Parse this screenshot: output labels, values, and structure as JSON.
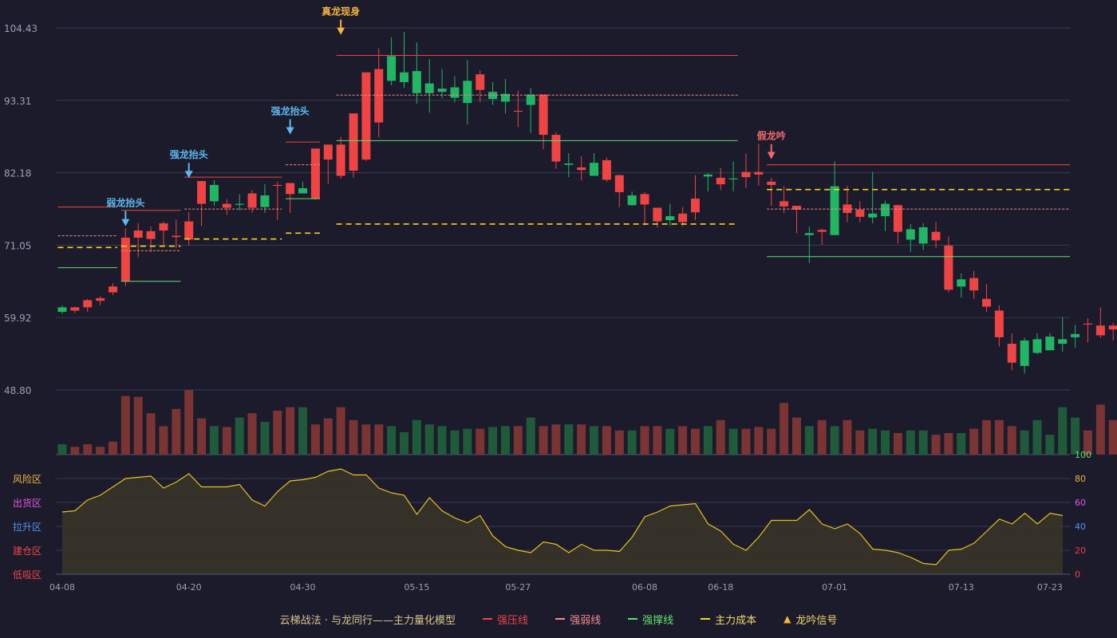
{
  "legend": {
    "title": "云梯战法 · 与龙同行——主力量化模型",
    "items": [
      {
        "label": "强压线",
        "color": "#ef4444",
        "style": "solid"
      },
      {
        "label": "强弱线",
        "color": "#f08c8c",
        "style": "dashed"
      },
      {
        "label": "强撑线",
        "color": "#62e06a",
        "style": "solid"
      },
      {
        "label": "主力成本",
        "color": "#f7d51c",
        "style": "dashed"
      },
      {
        "label": "龙吟信号",
        "color": "#f2b33d",
        "style": "triangle"
      }
    ]
  },
  "chart_data": {
    "type": "candlestick",
    "x_axis": {
      "categories": [
        "04-08",
        "04-09",
        "04-10",
        "04-11",
        "04-12",
        "04-15",
        "04-16",
        "04-17",
        "04-18",
        "04-19",
        "04-20",
        "04-22",
        "04-23",
        "04-24",
        "04-25",
        "04-26",
        "04-27",
        "04-28",
        "04-29",
        "04-30",
        "05-01",
        "05-06",
        "05-07",
        "05-08",
        "05-09",
        "05-10",
        "05-13",
        "05-14",
        "05-15",
        "05-16",
        "05-17",
        "05-20",
        "05-21",
        "05-22",
        "05-23",
        "05-24",
        "05-27",
        "05-28",
        "05-29",
        "05-30",
        "05-31",
        "06-03",
        "06-04",
        "06-05",
        "06-06",
        "06-07",
        "06-08",
        "06-11",
        "06-12",
        "06-13",
        "06-14",
        "06-17",
        "06-18",
        "06-19",
        "06-20",
        "06-21",
        "06-24",
        "06-25",
        "06-26",
        "06-27",
        "06-28",
        "07-01",
        "07-02",
        "07-03",
        "07-04",
        "07-05",
        "07-08",
        "07-09",
        "07-10",
        "07-11",
        "07-12",
        "07-13",
        "07-15",
        "07-16",
        "07-17",
        "07-18",
        "07-19",
        "07-22",
        "07-23",
        "07-24",
        "07-25",
        "07-26",
        "07-29",
        "07-30",
        "07-31",
        "08-01",
        "08-02"
      ],
      "tick_labels": [
        "04-08",
        "04-20",
        "04-30",
        "05-15",
        "05-27",
        "06-08",
        "06-18",
        "07-01",
        "07-13",
        "07-23"
      ]
    },
    "price_axis": {
      "ticks": [
        "104.43",
        "93.31",
        "82.18",
        "71.05",
        "59.92",
        "48.80"
      ],
      "range": [
        48.8,
        104.43
      ]
    },
    "candles": {
      "open": [
        61.5,
        61.0,
        61.5,
        62.5,
        63.8,
        65.5,
        72.2,
        72.0,
        73.3,
        72.3,
        71.9,
        77.4,
        80.3,
        76.8,
        77.4,
        76.8,
        78.7,
        80.3,
        78.9,
        79.8,
        78.2,
        84.2,
        81.7,
        82.5,
        84.2,
        89.9,
        100.1,
        97.6,
        97.8,
        95.9,
        95.1,
        95.3,
        96.3,
        94.9,
        94.6,
        94.3,
        91.6,
        94.2,
        88.0,
        83.9,
        83.6,
        82.6,
        83.7,
        81.1,
        79.2,
        78.7,
        77.3,
        74.7,
        75.5,
        74.6,
        76.1,
        81.9,
        80.4,
        81.3,
        81.5,
        81.9,
        80.3,
        77.0,
        76.5,
        72.9,
        73.1,
        80.1,
        76.0,
        75.4,
        75.9,
        77.4,
        73.1,
        73.5,
        73.8,
        71.8,
        64.2,
        65.8,
        64.1,
        61.6,
        56.9,
        53.0,
        56.4,
        56.6,
        57.0,
        56.6,
        57.4,
        59.0,
        57.2,
        58.1,
        58.1,
        57.4,
        59.3
      ],
      "high": [
        61.8,
        61.6,
        62.8,
        63.2,
        65.2,
        73.6,
        74.4,
        73.9,
        74.7,
        75.0,
        76.1,
        80.8,
        81.0,
        78.1,
        78.9,
        79.5,
        80.4,
        80.8,
        80.5,
        80.8,
        84.6,
        86.0,
        87.7,
        87.7,
        90.3,
        101.3,
        103.0,
        103.8,
        102.2,
        99.6,
        98.1,
        97.0,
        99.5,
        97.9,
        96.1,
        96.6,
        94.8,
        95.2,
        94.1,
        88.4,
        85.2,
        84.7,
        85.2,
        84.5,
        81.9,
        79.3,
        79.2,
        75.8,
        77.4,
        76.9,
        81.8,
        82.1,
        82.9,
        83.9,
        85.1,
        86.6,
        81.4,
        80.1,
        76.5,
        73.9,
        73.6,
        83.9,
        80.2,
        77.8,
        82.3,
        77.9,
        77.3,
        74.3,
        74.4,
        74.6,
        72.4,
        66.7,
        67.1,
        65.0,
        61.8,
        57.5,
        56.8,
        57.5,
        57.5,
        60.0,
        58.8,
        59.8,
        61.5,
        59.1,
        60.4,
        59.8,
        59.9
      ],
      "low": [
        60.5,
        60.6,
        60.8,
        61.8,
        63.4,
        64.8,
        69.2,
        70.0,
        71.0,
        70.6,
        71.0,
        74.0,
        77.1,
        75.7,
        76.4,
        76.0,
        76.0,
        74.9,
        76.0,
        79.1,
        78.0,
        80.5,
        81.3,
        81.4,
        84.0,
        87.6,
        95.6,
        95.2,
        92.8,
        91.4,
        93.6,
        93.0,
        89.6,
        93.0,
        92.6,
        91.3,
        89.2,
        88.3,
        85.8,
        82.8,
        81.5,
        81.0,
        82.1,
        80.8,
        76.9,
        77.1,
        74.1,
        73.8,
        74.0,
        73.9,
        74.9,
        79.3,
        79.5,
        79.3,
        79.8,
        80.2,
        77.1,
        76.0,
        72.9,
        68.3,
        71.1,
        73.5,
        74.6,
        74.6,
        74.4,
        73.2,
        71.3,
        70.0,
        70.3,
        70.6,
        63.8,
        63.0,
        62.8,
        60.8,
        55.5,
        51.8,
        51.3,
        54.3,
        55.1,
        54.7,
        55.3,
        56.1,
        56.8,
        56.4,
        55.4,
        56.7,
        56.9
      ],
      "close": [
        60.8,
        61.5,
        62.6,
        62.9,
        64.7,
        72.2,
        73.3,
        73.2,
        74.4,
        72.5,
        74.7,
        80.9,
        77.8,
        77.4,
        77.3,
        79.0,
        76.9,
        80.3,
        80.6,
        79.0,
        85.9,
        86.5,
        86.5,
        91.3,
        97.6,
        98.1,
        96.3,
        96.1,
        94.4,
        94.4,
        94.6,
        93.7,
        92.9,
        97.3,
        93.5,
        93.1,
        91.7,
        92.6,
        94.2,
        88.0,
        83.4,
        83.0,
        81.7,
        84.1,
        81.8,
        77.2,
        78.9,
        76.8,
        74.9,
        75.9,
        78.2,
        81.6,
        81.4,
        81.2,
        82.3,
        82.3,
        80.8,
        77.8,
        77.1,
        72.6,
        73.4,
        72.6,
        77.3,
        76.5,
        75.3,
        75.5,
        77.2,
        71.9,
        71.3,
        73.1,
        71.0,
        64.7,
        66.0,
        62.8,
        61.0,
        55.9,
        52.5,
        54.5,
        54.9,
        55.9,
        56.9,
        59.0,
        58.7,
        58.7,
        55.7,
        57.8,
        58.1
      ]
    },
    "volume": {
      "values": [
        12,
        9,
        12,
        9,
        15,
        68,
        67,
        48,
        33,
        53,
        75,
        42,
        33,
        32,
        43,
        48,
        38,
        51,
        55,
        55,
        35,
        42,
        55,
        40,
        35,
        35,
        33,
        26,
        40,
        35,
        33,
        28,
        30,
        30,
        32,
        33,
        33,
        43,
        33,
        35,
        35,
        35,
        33,
        33,
        28,
        28,
        33,
        33,
        30,
        33,
        30,
        33,
        40,
        30,
        30,
        32,
        30,
        60,
        43,
        33,
        40,
        33,
        40,
        28,
        30,
        28,
        25,
        28,
        28,
        23,
        25,
        25,
        30,
        40,
        40,
        33,
        28,
        40,
        23,
        55,
        43,
        28,
        58,
        40,
        40,
        43,
        28
      ],
      "up_color": "#7a3434",
      "down_color": "#1f5b3a"
    },
    "oscillator": {
      "name": "",
      "values": [
        52,
        53,
        62,
        66,
        73,
        80,
        81,
        82,
        72,
        77,
        84,
        73,
        73,
        73,
        75,
        62,
        57,
        69,
        78,
        79,
        81,
        86,
        88,
        83,
        83,
        72,
        68,
        66,
        50,
        64,
        53,
        47,
        43,
        49,
        32,
        23,
        20,
        18,
        27,
        25,
        18,
        25,
        20,
        20,
        19,
        31,
        48,
        52,
        57,
        58,
        59,
        42,
        36,
        25,
        20,
        31,
        45,
        45,
        45,
        54,
        42,
        38,
        42,
        34,
        21,
        20,
        18,
        14,
        9,
        8,
        20,
        21,
        26,
        36,
        46,
        42,
        51,
        42,
        51,
        49
      ],
      "right_ticks": [
        "100",
        "80",
        "60",
        "40",
        "20",
        "0"
      ],
      "zones": [
        {
          "label": "风险区",
          "color": "#f2b33d"
        },
        {
          "label": "出货区",
          "color": "#e455e4"
        },
        {
          "label": "拉升区",
          "color": "#4f94f2"
        },
        {
          "label": "建仓区",
          "color": "#ef4444"
        },
        {
          "label": "低吸区",
          "color": "#ef4444"
        }
      ]
    },
    "lines": [
      {
        "type": "resistance",
        "color": "#ef4444",
        "style": "solid",
        "from": 0,
        "to": 4,
        "y": 76.9
      },
      {
        "type": "pivot",
        "color": "#f08c8c",
        "style": "dashed",
        "from": 0,
        "to": 4,
        "y": 72.5
      },
      {
        "type": "cost",
        "color": "#f7d51c",
        "style": "dashed",
        "from": 0,
        "to": 4,
        "y": 70.7
      },
      {
        "type": "support",
        "color": "#62e06a",
        "style": "solid",
        "from": 0,
        "to": 4,
        "y": 67.6
      },
      {
        "type": "resistance",
        "color": "#ef4444",
        "style": "solid",
        "from": 5,
        "to": 9,
        "y": 76.4
      },
      {
        "type": "pivot",
        "color": "#f08c8c",
        "style": "dashed",
        "from": 5,
        "to": 9,
        "y": 70.2
      },
      {
        "type": "cost",
        "color": "#f7d51c",
        "style": "dashed",
        "from": 5,
        "to": 9,
        "y": 70.9
      },
      {
        "type": "support",
        "color": "#62e06a",
        "style": "solid",
        "from": 5,
        "to": 9,
        "y": 65.5
      },
      {
        "type": "resistance",
        "color": "#ef4444",
        "style": "solid",
        "from": 10,
        "to": 17,
        "y": 81.5
      },
      {
        "type": "pivot",
        "color": "#f08c8c",
        "style": "dashed",
        "from": 10,
        "to": 17,
        "y": 76.6
      },
      {
        "type": "cost",
        "color": "#f7d51c",
        "style": "dashed",
        "from": 10,
        "to": 17,
        "y": 72.0
      },
      {
        "type": "resistance",
        "color": "#ef4444",
        "style": "solid",
        "from": 18,
        "to": 20,
        "y": 86.9
      },
      {
        "type": "pivot",
        "color": "#f08c8c",
        "style": "dashed",
        "from": 18,
        "to": 20,
        "y": 83.4
      },
      {
        "type": "support",
        "color": "#62e06a",
        "style": "solid",
        "from": 18,
        "to": 20,
        "y": 78.2
      },
      {
        "type": "cost",
        "color": "#f7d51c",
        "style": "dashed",
        "from": 18,
        "to": 20,
        "y": 72.9
      },
      {
        "type": "resistance",
        "color": "#ef4444",
        "style": "solid",
        "from": 22,
        "to": 53,
        "y": 100.2
      },
      {
        "type": "pivot",
        "color": "#f08c8c",
        "style": "dashed",
        "from": 22,
        "to": 53,
        "y": 94.1
      },
      {
        "type": "support",
        "color": "#62e06a",
        "style": "solid",
        "from": 22,
        "to": 53,
        "y": 87.1
      },
      {
        "type": "cost",
        "color": "#f7d51c",
        "style": "dashed",
        "from": 22,
        "to": 53,
        "y": 74.3
      },
      {
        "type": "resistance",
        "color": "#ef4444",
        "style": "solid",
        "from": 56,
        "to": 86,
        "y": 83.4
      },
      {
        "type": "pivot",
        "color": "#f08c8c",
        "style": "dashed",
        "from": 56,
        "to": 86,
        "y": 76.6
      },
      {
        "type": "cost",
        "color": "#f7d51c",
        "style": "dashed",
        "from": 56,
        "to": 86,
        "y": 79.6
      },
      {
        "type": "support",
        "color": "#62e06a",
        "style": "solid",
        "from": 56,
        "to": 86,
        "y": 69.3
      }
    ],
    "signals": [
      {
        "label": "弱龙抬头",
        "index": 5,
        "anchor": 73.6,
        "color": "#5cb8f0"
      },
      {
        "label": "强龙抬头",
        "index": 10,
        "anchor": 81.0,
        "color": "#5cb8f0"
      },
      {
        "label": "强龙抬头",
        "index": 18,
        "anchor": 87.7,
        "color": "#5cb8f0"
      },
      {
        "label": "真龙现身",
        "index": 22,
        "anchor": 103.0,
        "color": "#f2b33d"
      },
      {
        "label": "假龙吟",
        "index": 56,
        "anchor": 83.9,
        "color": "#f06a6a"
      }
    ],
    "up_color": "#ef4444",
    "down_color": "#22b564",
    "grid": true
  }
}
